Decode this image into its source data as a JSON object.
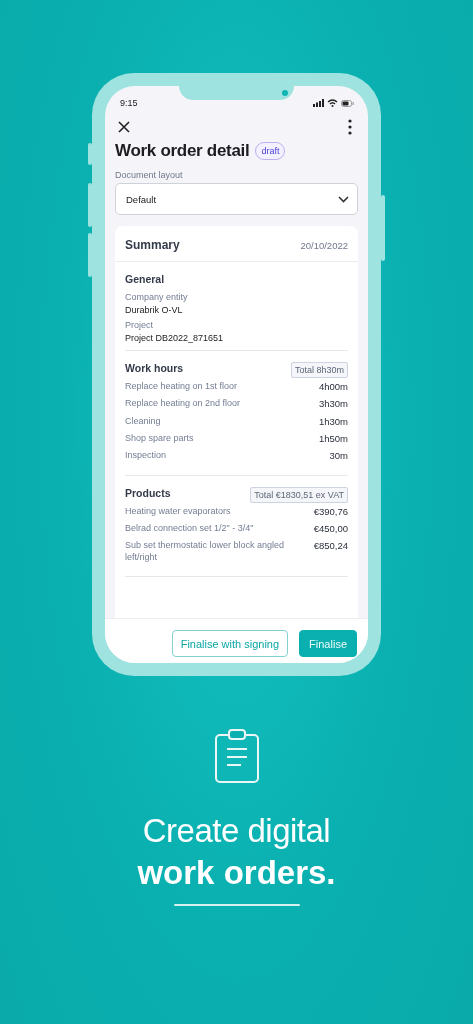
{
  "status_bar": {
    "time": "9:15"
  },
  "header": {
    "title": "Work order detail",
    "badge": "draft"
  },
  "layout_field": {
    "label": "Document layout",
    "value": "Default"
  },
  "summary": {
    "title": "Summary",
    "date": "20/10/2022",
    "general": {
      "title": "General",
      "fields": [
        {
          "label": "Company entity",
          "value": "Durabrik O-VL"
        },
        {
          "label": "Project",
          "value": "Project DB2022_871651"
        }
      ]
    },
    "sections": [
      {
        "title": "Work hours",
        "total": "Total 8h30m",
        "rows": [
          {
            "label": "Replace heating on 1st floor",
            "value": "4h00m"
          },
          {
            "label": "Replace heating on 2nd floor",
            "value": "3h30m"
          },
          {
            "label": "Cleaning",
            "value": "1h30m"
          },
          {
            "label": "Shop spare parts",
            "value": "1h50m"
          },
          {
            "label": "Inspection",
            "value": "30m"
          }
        ]
      },
      {
        "title": "Products",
        "total": "Total €1830,51 ex VAT",
        "rows": [
          {
            "label": "Heating water evaporators",
            "value": "€390,76"
          },
          {
            "label": "Belrad connection set 1/2\" - 3/4\"",
            "value": "€450,00"
          },
          {
            "label": "Sub set thermostatic lower block angled left/right",
            "value": "€850,24"
          }
        ]
      }
    ]
  },
  "buttons": [
    {
      "label": "Finalise with signing",
      "kind": "outline"
    },
    {
      "label": "Finalise",
      "kind": "primary"
    }
  ],
  "headline": {
    "line1": "Create digital",
    "line2": "work orders."
  }
}
